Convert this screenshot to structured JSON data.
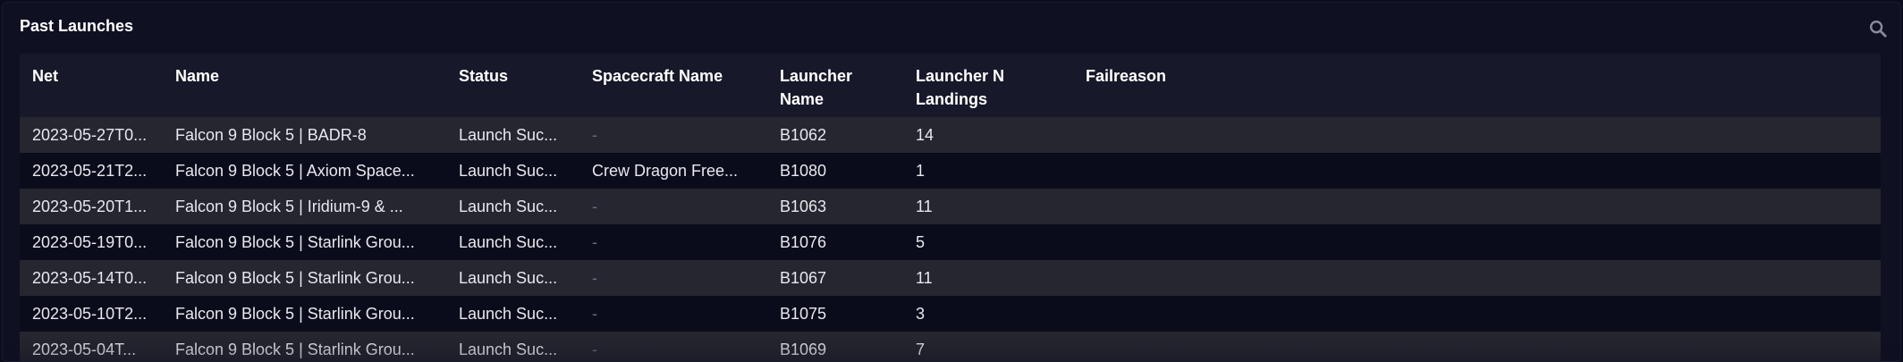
{
  "panel": {
    "title": "Past Launches",
    "search_icon": "search-icon"
  },
  "table": {
    "columns": [
      {
        "key": "net",
        "label": "Net"
      },
      {
        "key": "name",
        "label": "Name"
      },
      {
        "key": "status",
        "label": "Status"
      },
      {
        "key": "spacecraft_name",
        "label": "Spacecraft Name"
      },
      {
        "key": "launcher_name",
        "label": "Launcher Name"
      },
      {
        "key": "launcher_n_landings",
        "label": "Launcher N Landings"
      },
      {
        "key": "failreason",
        "label": "Failreason"
      }
    ],
    "rows": [
      {
        "net": "2023-05-27T0...",
        "name": "Falcon 9 Block 5 | BADR-8",
        "status": "Launch Suc...",
        "spacecraft_name": "-",
        "launcher_name": "B1062",
        "launcher_n_landings": "14",
        "failreason": ""
      },
      {
        "net": "2023-05-21T2...",
        "name": "Falcon 9 Block 5 | Axiom Space...",
        "status": "Launch Suc...",
        "spacecraft_name": "Crew Dragon Free...",
        "launcher_name": "B1080",
        "launcher_n_landings": "1",
        "failreason": ""
      },
      {
        "net": "2023-05-20T1...",
        "name": "Falcon 9 Block 5 | Iridium-9 & ...",
        "status": "Launch Suc...",
        "spacecraft_name": "-",
        "launcher_name": "B1063",
        "launcher_n_landings": "11",
        "failreason": ""
      },
      {
        "net": "2023-05-19T0...",
        "name": "Falcon 9 Block 5 | Starlink Grou...",
        "status": "Launch Suc...",
        "spacecraft_name": "-",
        "launcher_name": "B1076",
        "launcher_n_landings": "5",
        "failreason": ""
      },
      {
        "net": "2023-05-14T0...",
        "name": "Falcon 9 Block 5 | Starlink Grou...",
        "status": "Launch Suc...",
        "spacecraft_name": "-",
        "launcher_name": "B1067",
        "launcher_n_landings": "11",
        "failreason": ""
      },
      {
        "net": "2023-05-10T2...",
        "name": "Falcon 9 Block 5 | Starlink Grou...",
        "status": "Launch Suc...",
        "spacecraft_name": "-",
        "launcher_name": "B1075",
        "launcher_n_landings": "3",
        "failreason": ""
      },
      {
        "net": "2023-05-04T...",
        "name": "Falcon 9 Block 5 | Starlink Grou...",
        "status": "Launch Suc...",
        "spacecraft_name": "-",
        "launcher_name": "B1069",
        "launcher_n_landings": "7",
        "failreason": ""
      }
    ]
  },
  "colors": {
    "background": "#0c0d1c",
    "header_row": "#171829",
    "row_odd": "#25262f",
    "row_even": "#0b0c1b",
    "text": "#e8e9ee",
    "muted": "#6c6e7c"
  }
}
